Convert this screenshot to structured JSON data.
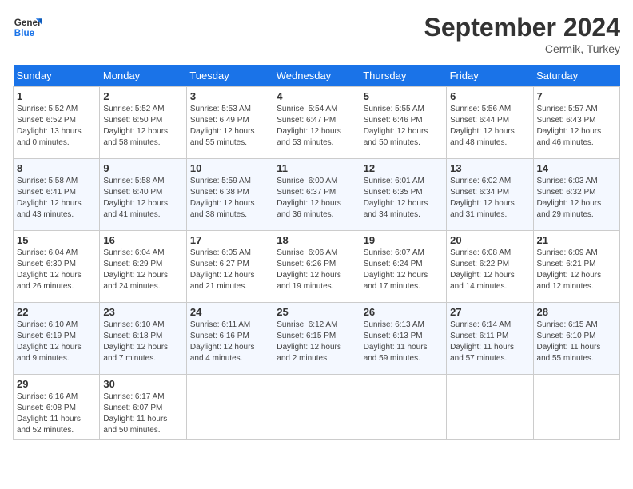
{
  "header": {
    "logo_line1": "General",
    "logo_line2": "Blue",
    "month_title": "September 2024",
    "subtitle": "Cermik, Turkey"
  },
  "days_of_week": [
    "Sunday",
    "Monday",
    "Tuesday",
    "Wednesday",
    "Thursday",
    "Friday",
    "Saturday"
  ],
  "weeks": [
    [
      {
        "day": "1",
        "lines": [
          "Sunrise: 5:52 AM",
          "Sunset: 6:52 PM",
          "Daylight: 13 hours",
          "and 0 minutes."
        ]
      },
      {
        "day": "2",
        "lines": [
          "Sunrise: 5:52 AM",
          "Sunset: 6:50 PM",
          "Daylight: 12 hours",
          "and 58 minutes."
        ]
      },
      {
        "day": "3",
        "lines": [
          "Sunrise: 5:53 AM",
          "Sunset: 6:49 PM",
          "Daylight: 12 hours",
          "and 55 minutes."
        ]
      },
      {
        "day": "4",
        "lines": [
          "Sunrise: 5:54 AM",
          "Sunset: 6:47 PM",
          "Daylight: 12 hours",
          "and 53 minutes."
        ]
      },
      {
        "day": "5",
        "lines": [
          "Sunrise: 5:55 AM",
          "Sunset: 6:46 PM",
          "Daylight: 12 hours",
          "and 50 minutes."
        ]
      },
      {
        "day": "6",
        "lines": [
          "Sunrise: 5:56 AM",
          "Sunset: 6:44 PM",
          "Daylight: 12 hours",
          "and 48 minutes."
        ]
      },
      {
        "day": "7",
        "lines": [
          "Sunrise: 5:57 AM",
          "Sunset: 6:43 PM",
          "Daylight: 12 hours",
          "and 46 minutes."
        ]
      }
    ],
    [
      {
        "day": "8",
        "lines": [
          "Sunrise: 5:58 AM",
          "Sunset: 6:41 PM",
          "Daylight: 12 hours",
          "and 43 minutes."
        ]
      },
      {
        "day": "9",
        "lines": [
          "Sunrise: 5:58 AM",
          "Sunset: 6:40 PM",
          "Daylight: 12 hours",
          "and 41 minutes."
        ]
      },
      {
        "day": "10",
        "lines": [
          "Sunrise: 5:59 AM",
          "Sunset: 6:38 PM",
          "Daylight: 12 hours",
          "and 38 minutes."
        ]
      },
      {
        "day": "11",
        "lines": [
          "Sunrise: 6:00 AM",
          "Sunset: 6:37 PM",
          "Daylight: 12 hours",
          "and 36 minutes."
        ]
      },
      {
        "day": "12",
        "lines": [
          "Sunrise: 6:01 AM",
          "Sunset: 6:35 PM",
          "Daylight: 12 hours",
          "and 34 minutes."
        ]
      },
      {
        "day": "13",
        "lines": [
          "Sunrise: 6:02 AM",
          "Sunset: 6:34 PM",
          "Daylight: 12 hours",
          "and 31 minutes."
        ]
      },
      {
        "day": "14",
        "lines": [
          "Sunrise: 6:03 AM",
          "Sunset: 6:32 PM",
          "Daylight: 12 hours",
          "and 29 minutes."
        ]
      }
    ],
    [
      {
        "day": "15",
        "lines": [
          "Sunrise: 6:04 AM",
          "Sunset: 6:30 PM",
          "Daylight: 12 hours",
          "and 26 minutes."
        ]
      },
      {
        "day": "16",
        "lines": [
          "Sunrise: 6:04 AM",
          "Sunset: 6:29 PM",
          "Daylight: 12 hours",
          "and 24 minutes."
        ]
      },
      {
        "day": "17",
        "lines": [
          "Sunrise: 6:05 AM",
          "Sunset: 6:27 PM",
          "Daylight: 12 hours",
          "and 21 minutes."
        ]
      },
      {
        "day": "18",
        "lines": [
          "Sunrise: 6:06 AM",
          "Sunset: 6:26 PM",
          "Daylight: 12 hours",
          "and 19 minutes."
        ]
      },
      {
        "day": "19",
        "lines": [
          "Sunrise: 6:07 AM",
          "Sunset: 6:24 PM",
          "Daylight: 12 hours",
          "and 17 minutes."
        ]
      },
      {
        "day": "20",
        "lines": [
          "Sunrise: 6:08 AM",
          "Sunset: 6:22 PM",
          "Daylight: 12 hours",
          "and 14 minutes."
        ]
      },
      {
        "day": "21",
        "lines": [
          "Sunrise: 6:09 AM",
          "Sunset: 6:21 PM",
          "Daylight: 12 hours",
          "and 12 minutes."
        ]
      }
    ],
    [
      {
        "day": "22",
        "lines": [
          "Sunrise: 6:10 AM",
          "Sunset: 6:19 PM",
          "Daylight: 12 hours",
          "and 9 minutes."
        ]
      },
      {
        "day": "23",
        "lines": [
          "Sunrise: 6:10 AM",
          "Sunset: 6:18 PM",
          "Daylight: 12 hours",
          "and 7 minutes."
        ]
      },
      {
        "day": "24",
        "lines": [
          "Sunrise: 6:11 AM",
          "Sunset: 6:16 PM",
          "Daylight: 12 hours",
          "and 4 minutes."
        ]
      },
      {
        "day": "25",
        "lines": [
          "Sunrise: 6:12 AM",
          "Sunset: 6:15 PM",
          "Daylight: 12 hours",
          "and 2 minutes."
        ]
      },
      {
        "day": "26",
        "lines": [
          "Sunrise: 6:13 AM",
          "Sunset: 6:13 PM",
          "Daylight: 11 hours",
          "and 59 minutes."
        ]
      },
      {
        "day": "27",
        "lines": [
          "Sunrise: 6:14 AM",
          "Sunset: 6:11 PM",
          "Daylight: 11 hours",
          "and 57 minutes."
        ]
      },
      {
        "day": "28",
        "lines": [
          "Sunrise: 6:15 AM",
          "Sunset: 6:10 PM",
          "Daylight: 11 hours",
          "and 55 minutes."
        ]
      }
    ],
    [
      {
        "day": "29",
        "lines": [
          "Sunrise: 6:16 AM",
          "Sunset: 6:08 PM",
          "Daylight: 11 hours",
          "and 52 minutes."
        ]
      },
      {
        "day": "30",
        "lines": [
          "Sunrise: 6:17 AM",
          "Sunset: 6:07 PM",
          "Daylight: 11 hours",
          "and 50 minutes."
        ]
      },
      {
        "day": "",
        "lines": []
      },
      {
        "day": "",
        "lines": []
      },
      {
        "day": "",
        "lines": []
      },
      {
        "day": "",
        "lines": []
      },
      {
        "day": "",
        "lines": []
      }
    ]
  ]
}
